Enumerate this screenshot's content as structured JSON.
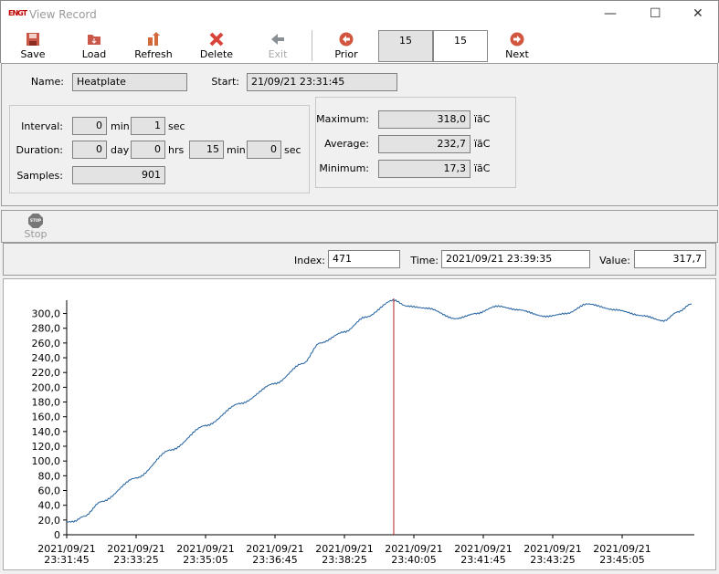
{
  "window": {
    "title": "View Record",
    "logo": "ENGT"
  },
  "toolbar": {
    "save": "Save",
    "load": "Load",
    "refresh": "Refresh",
    "delete": "Delete",
    "exit": "Exit",
    "prior": "Prior",
    "next": "Next",
    "counter_a": "15",
    "counter_b": "15"
  },
  "record": {
    "name_label": "Name:",
    "name": "Heatplate",
    "start_label": "Start:",
    "start": "21/09/21 23:31:45",
    "interval_label": "Interval:",
    "interval_min": "0",
    "interval_sec": "1",
    "duration_label": "Duration:",
    "dur_day": "0",
    "dur_hrs": "0",
    "dur_min": "15",
    "dur_sec": "0",
    "samples_label": "Samples:",
    "samples": "901",
    "units": {
      "min": "min",
      "sec": "sec",
      "day": "day",
      "hrs": "hrs"
    },
    "max_label": "Maximum:",
    "max": "318,0",
    "avg_label": "Average:",
    "avg": "232,7",
    "min_label": "Minimum:",
    "min": "17,3",
    "temp_unit": "ïãC"
  },
  "stop": {
    "label": "Stop",
    "icon_text": "STOP"
  },
  "cursor": {
    "index_label": "Index:",
    "index": "471",
    "time_label": "Time:",
    "time": "2021/09/21 23:39:35",
    "value_label": "Value:",
    "value": "317,7"
  },
  "colors": {
    "line": "#1f5f9f",
    "cursor": "#b22222"
  },
  "chart_data": {
    "type": "line",
    "ylim": [
      0,
      318
    ],
    "xlim": [
      0,
      900
    ],
    "yticks": [
      "0",
      "20,0",
      "40,0",
      "60,0",
      "80,0",
      "100,0",
      "120,0",
      "140,0",
      "160,0",
      "180,0",
      "200,0",
      "220,0",
      "240,0",
      "260,0",
      "280,0",
      "300,0"
    ],
    "xticks": [
      {
        "s": 0,
        "d": "2021/09/21",
        "t": "23:31:45"
      },
      {
        "s": 100,
        "d": "2021/09/21",
        "t": "23:33:25"
      },
      {
        "s": 200,
        "d": "2021/09/21",
        "t": "23:35:05"
      },
      {
        "s": 300,
        "d": "2021/09/21",
        "t": "23:36:45"
      },
      {
        "s": 400,
        "d": "2021/09/21",
        "t": "23:38:25"
      },
      {
        "s": 500,
        "d": "2021/09/21",
        "t": "23:40:05"
      },
      {
        "s": 600,
        "d": "2021/09/21",
        "t": "23:41:45"
      },
      {
        "s": 700,
        "d": "2021/09/21",
        "t": "23:43:25"
      },
      {
        "s": 800,
        "d": "2021/09/21",
        "t": "23:45:05"
      }
    ],
    "cursor_x": 471,
    "points": [
      [
        0,
        17.3
      ],
      [
        10,
        18
      ],
      [
        25,
        25
      ],
      [
        50,
        45
      ],
      [
        100,
        77
      ],
      [
        150,
        115
      ],
      [
        200,
        148
      ],
      [
        250,
        178
      ],
      [
        300,
        205
      ],
      [
        340,
        232
      ],
      [
        365,
        260
      ],
      [
        400,
        275
      ],
      [
        430,
        295
      ],
      [
        471,
        318
      ],
      [
        490,
        310
      ],
      [
        520,
        307
      ],
      [
        560,
        293
      ],
      [
        590,
        300
      ],
      [
        620,
        310
      ],
      [
        650,
        305
      ],
      [
        690,
        296
      ],
      [
        720,
        300
      ],
      [
        750,
        313
      ],
      [
        790,
        305
      ],
      [
        830,
        297
      ],
      [
        860,
        290
      ],
      [
        880,
        302
      ],
      [
        900,
        313
      ]
    ]
  }
}
